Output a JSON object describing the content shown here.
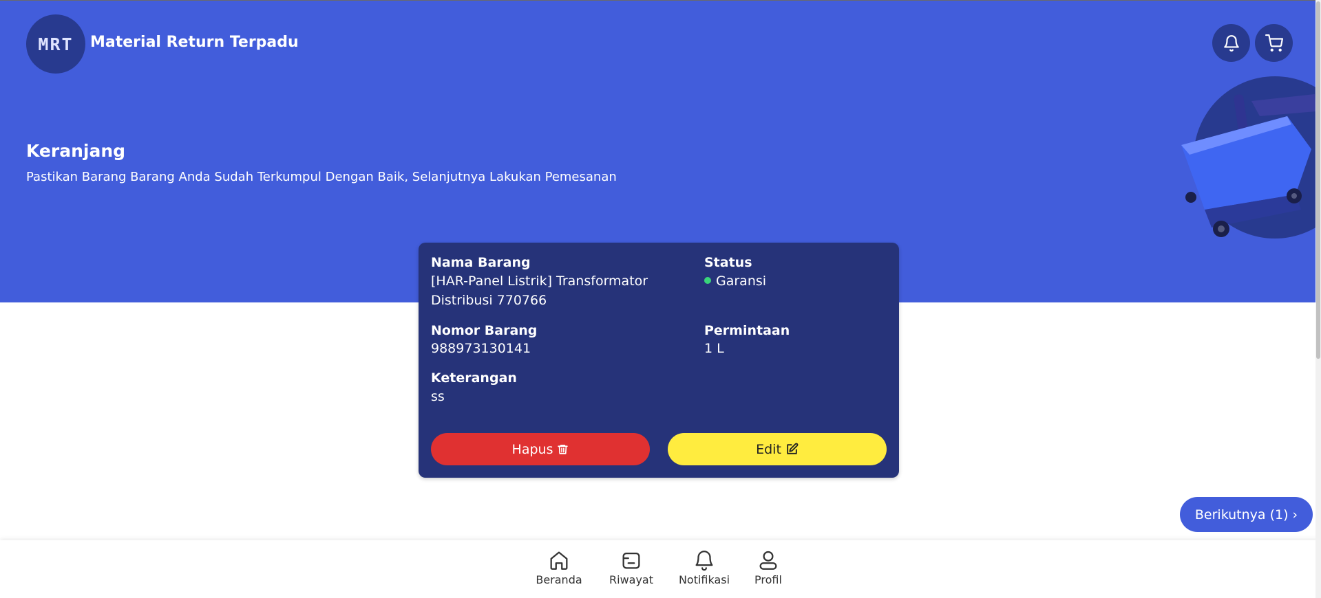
{
  "header": {
    "logo_text": "MRT",
    "app_title": "Material Return Terpadu",
    "icons": [
      "bell-icon",
      "cart-icon"
    ]
  },
  "hero": {
    "title": "Keranjang",
    "subtitle": "Pastikan Barang Barang Anda Sudah Terkumpul Dengan Baik, Selanjutnya Lakukan Pemesanan"
  },
  "item": {
    "name_label": "Nama Barang",
    "name_value": "[HAR-Panel Listrik] Transformator Distribusi 770766",
    "status_label": "Status",
    "status_value": "Garansi",
    "number_label": "Nomor Barang",
    "number_value": "988973130141",
    "request_label": "Permintaan",
    "request_value": "1 L",
    "note_label": "Keterangan",
    "note_value": "ss",
    "delete_label": "Hapus",
    "edit_label": "Edit"
  },
  "next_button": {
    "label": "Berikutnya (1) ›"
  },
  "bottom_nav": [
    {
      "label": "Beranda",
      "icon": "home-icon"
    },
    {
      "label": "Riwayat",
      "icon": "history-icon"
    },
    {
      "label": "Notifikasi",
      "icon": "bell-icon"
    },
    {
      "label": "Profil",
      "icon": "user-icon"
    }
  ],
  "colors": {
    "primary": "#425ddb",
    "dark": "#283a8f",
    "card": "#263379",
    "danger": "#e03131",
    "warning": "#ffec3f",
    "status_ok": "#39d67a"
  }
}
